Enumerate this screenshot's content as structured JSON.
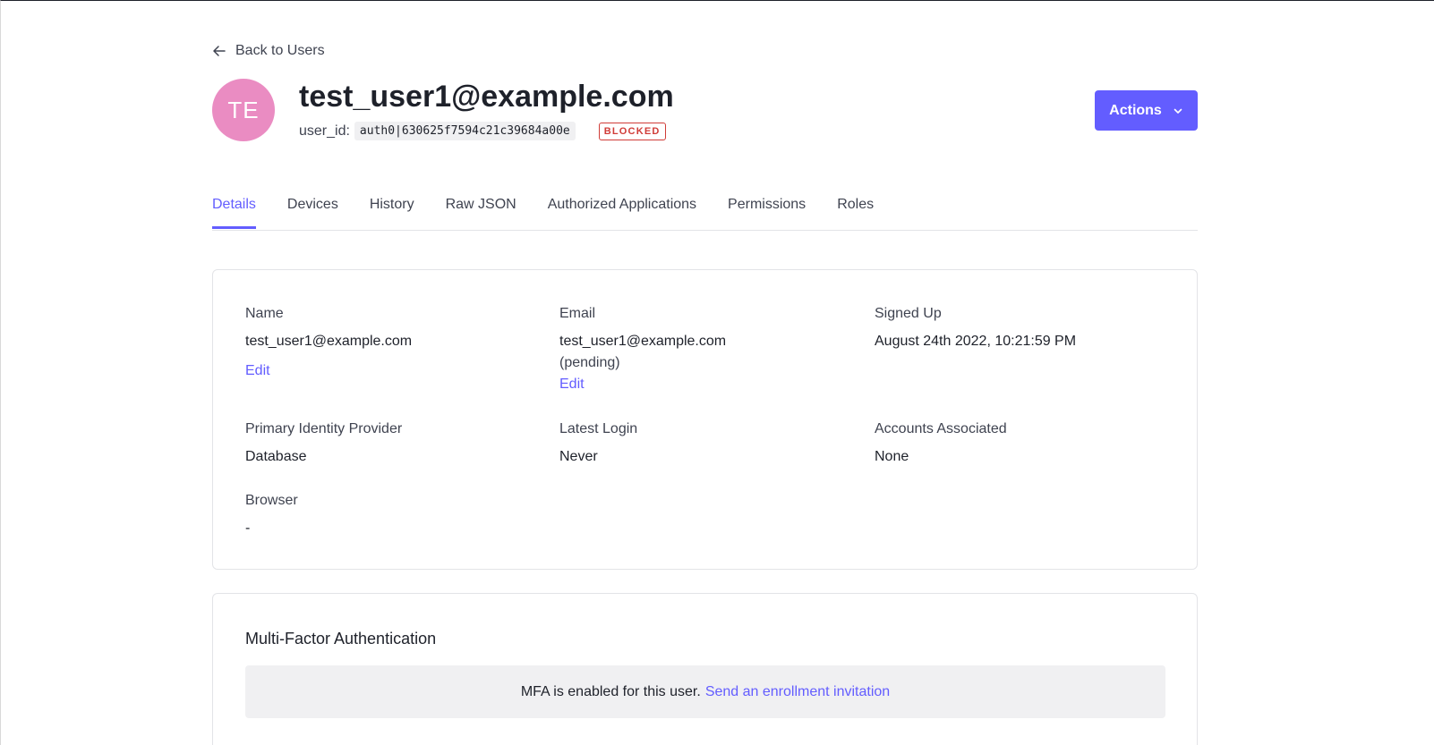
{
  "back_link": {
    "label": "Back to Users",
    "icon": "arrow-left-icon"
  },
  "user": {
    "initials": "TE",
    "avatar_color": "#ea8cc2",
    "email": "test_user1@example.com",
    "user_id_label": "user_id:",
    "user_id": "auth0|630625f7594c21c39684a00e",
    "status_badge": "BLOCKED"
  },
  "actions_button": {
    "label": "Actions",
    "icon": "chevron-down-icon"
  },
  "tabs": [
    {
      "label": "Details",
      "active": true
    },
    {
      "label": "Devices",
      "active": false
    },
    {
      "label": "History",
      "active": false
    },
    {
      "label": "Raw JSON",
      "active": false
    },
    {
      "label": "Authorized Applications",
      "active": false
    },
    {
      "label": "Permissions",
      "active": false
    },
    {
      "label": "Roles",
      "active": false
    }
  ],
  "details": {
    "name": {
      "label": "Name",
      "value": "test_user1@example.com",
      "edit": "Edit"
    },
    "email": {
      "label": "Email",
      "value": "test_user1@example.com",
      "status": "(pending)",
      "edit": "Edit"
    },
    "signed_up": {
      "label": "Signed Up",
      "value": "August 24th 2022, 10:21:59 PM"
    },
    "identity_provider": {
      "label": "Primary Identity Provider",
      "value": "Database"
    },
    "latest_login": {
      "label": "Latest Login",
      "value": "Never"
    },
    "accounts_associated": {
      "label": "Accounts Associated",
      "value": "None"
    },
    "browser": {
      "label": "Browser",
      "value": "-"
    }
  },
  "mfa": {
    "title": "Multi-Factor Authentication",
    "message": "MFA is enabled for this user.",
    "link": "Send an enrollment invitation"
  },
  "colors": {
    "accent": "#635dff",
    "blocked": "#d03c38",
    "text": "#1e212a",
    "muted": "#3f4350"
  }
}
